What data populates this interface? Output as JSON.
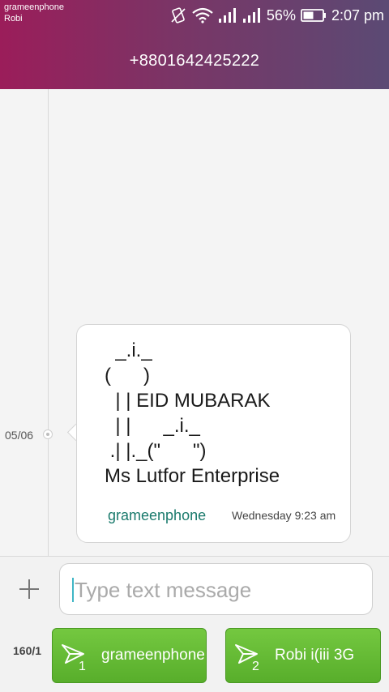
{
  "status_bar": {
    "carrier_1": "grameenphone",
    "carrier_2": "Robi",
    "battery": "56%",
    "time": "2:07 pm",
    "icons": [
      "vibrate-icon",
      "wifi-icon",
      "signal-icon",
      "signal-icon",
      "battery-icon"
    ]
  },
  "header": {
    "title": "+8801642425222",
    "gradient": [
      "#9b1d5a",
      "#5b4a74"
    ]
  },
  "conversation": {
    "date": "05/06",
    "message": {
      "lines": [
        "  _.i._",
        "(      )",
        "  | | EID MUBARAK",
        "  | |      _.i._",
        " .| |._(\"      \")",
        "Ms Lutfor Enterprise"
      ],
      "sender": "grameenphone",
      "time": "Wednesday 9:23 am"
    }
  },
  "compose": {
    "placeholder": "Type text message",
    "value": "",
    "counter": "160/1",
    "send_buttons": [
      {
        "sim": "1",
        "label": "grameenphone"
      },
      {
        "sim": "2",
        "label": "Robi i(iii 3G"
      }
    ],
    "accent": "#5cb531"
  }
}
